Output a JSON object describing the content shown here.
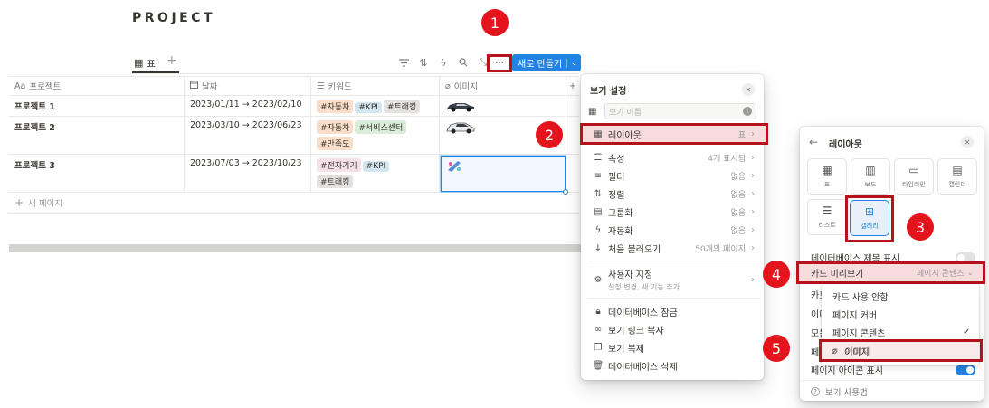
{
  "page": {
    "title": "PROJECT"
  },
  "view_tab": {
    "icon": "table-icon",
    "label": "표",
    "add": "+"
  },
  "toolbar": {
    "icons": [
      "filter-icon",
      "sort-icon",
      "automation-icon",
      "search-icon",
      "expand-icon"
    ],
    "more_label": "···",
    "new_label": "새로 만들기",
    "new_chevron": "⌄"
  },
  "table": {
    "columns": [
      {
        "icon": "Aa",
        "label": "프로젝트"
      },
      {
        "icon": "calendar-icon",
        "label": "날짜"
      },
      {
        "icon": "list-icon",
        "label": "키워드"
      },
      {
        "icon": "paperclip-icon",
        "label": "이미지"
      }
    ],
    "rows": [
      {
        "name": "프로젝트 1",
        "date": "2023/01/11 → 2023/02/10",
        "tags": [
          "#자동차",
          "#KPI",
          "#트래킹"
        ]
      },
      {
        "name": "프로젝트 2",
        "date": "2023/03/10 → 2023/06/23",
        "tags": [
          "#자동차",
          "#서비스센터",
          "#만족도"
        ]
      },
      {
        "name": "프로젝트 3",
        "date": "2023/07/03 → 2023/10/23",
        "tags": [
          "#전자기기",
          "#KPI",
          "#트래킹"
        ]
      }
    ],
    "new_page": "새 페이지",
    "add_col": "+"
  },
  "view_settings": {
    "title": "보기 설정",
    "name_placeholder": "보기 이름",
    "items": [
      {
        "icon": "table-icon",
        "label": "레이아웃",
        "value": "표"
      },
      {
        "icon": "list-icon",
        "label": "속성",
        "value": "4개 표시됨"
      },
      {
        "icon": "filter-icon",
        "label": "필터",
        "value": "없음"
      },
      {
        "icon": "sort-icon",
        "label": "정렬",
        "value": "없음"
      },
      {
        "icon": "group-icon",
        "label": "그룹화",
        "value": "없음"
      },
      {
        "icon": "automation-icon",
        "label": "자동화",
        "value": "없음"
      },
      {
        "icon": "arrow-down-icon",
        "label": "처음 불러오기",
        "value": "50개의 페이지"
      }
    ],
    "custom": {
      "label": "사용자 지정",
      "sub": "설정 변경, 새 기능 추가"
    },
    "bottom_items": [
      {
        "icon": "lock-icon",
        "label": "데이터베이스 잠금"
      },
      {
        "icon": "link-icon",
        "label": "보기 링크 복사"
      },
      {
        "icon": "duplicate-icon",
        "label": "보기 복제"
      },
      {
        "icon": "trash-icon",
        "label": "데이터베이스 삭제"
      }
    ]
  },
  "layout_panel": {
    "title": "레이아웃",
    "tiles": [
      "표",
      "보드",
      "타임라인",
      "캘린더",
      "리스트",
      "갤러리"
    ],
    "show_db_title": "데이터베이스 제목 표시",
    "card_preview": {
      "label": "카드 미리보기",
      "value": "페이지 콘텐츠"
    },
    "hidden_rows": [
      "카드",
      "이미",
      "모든",
      "페이"
    ],
    "show_page_icon": "페이지 아이콘 표시",
    "help": "보기 사용법"
  },
  "card_preview_options": {
    "items": [
      "카드 사용 안함",
      "페이지 커버",
      "페이지 콘텐츠",
      "이미지"
    ],
    "selected": "페이지 콘텐츠",
    "check": "✓"
  },
  "badges": [
    "1",
    "2",
    "3",
    "4",
    "5"
  ],
  "colors": {
    "accent_blue": "#2383e2",
    "highlight_red": "#b5121b",
    "badge_red": "#e3141b",
    "tag_orange": "#fadec9",
    "tag_blue": "#d3e5ef",
    "tag_gray": "#e3e2e0",
    "tag_green": "#dbeddb",
    "tag_pink": "#f5e0e9"
  }
}
